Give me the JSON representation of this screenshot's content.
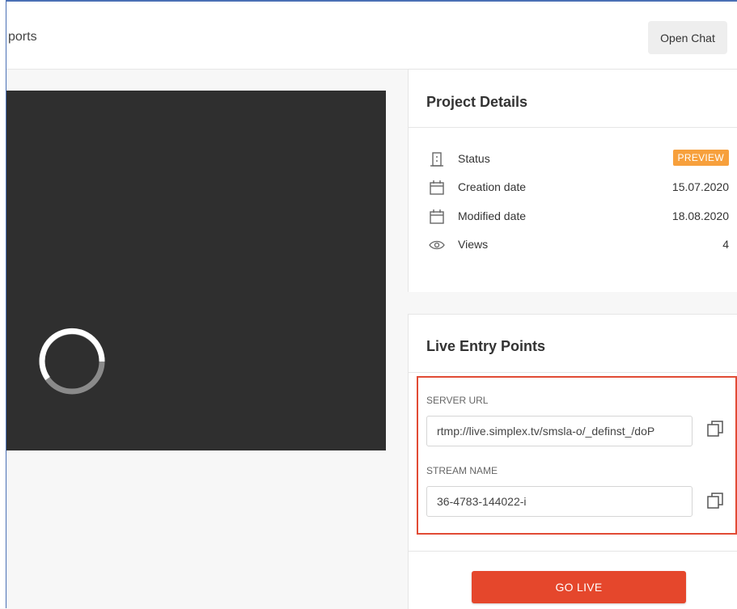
{
  "header": {
    "breadcrumb": "ports",
    "open_chat_label": "Open Chat"
  },
  "project_details": {
    "title": "Project Details",
    "rows": [
      {
        "icon": "building-icon",
        "label": "Status",
        "badge": "PREVIEW"
      },
      {
        "icon": "calendar-icon",
        "label": "Creation date",
        "value": "15.07.2020"
      },
      {
        "icon": "calendar-icon",
        "label": "Modified date",
        "value": "18.08.2020"
      },
      {
        "icon": "eye-icon",
        "label": "Views",
        "value": "4"
      }
    ]
  },
  "live_entry_points": {
    "title": "Live Entry Points",
    "server_url_label": "SERVER URL",
    "server_url_value": "rtmp://live.simplex.tv/smsla-o/_definst_/doP",
    "stream_name_label": "STREAM NAME",
    "stream_name_value": "36-4783-144022-i"
  },
  "go_live_label": "GO LIVE",
  "colors": {
    "accent": "#e5472c",
    "badge": "#f7a03c",
    "highlight_border": "#e14b35",
    "video_bg": "#2f2f2f"
  }
}
